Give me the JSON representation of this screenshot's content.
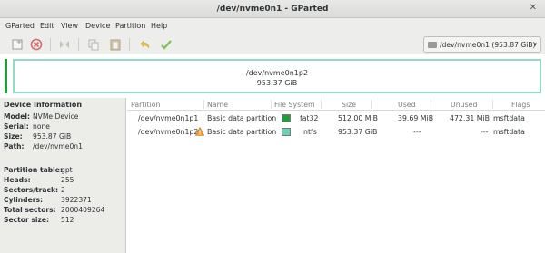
{
  "window": {
    "title": "/dev/nvme0n1 - GParted",
    "close_glyph": "✕"
  },
  "menu": [
    "GParted",
    "Edit",
    "View",
    "Device",
    "Partition",
    "Help"
  ],
  "toolbar": {
    "icons": [
      "new-partition-icon",
      "delete-partition-icon",
      "resize-move-icon",
      "copy-icon",
      "paste-icon",
      "undo-icon",
      "apply-icon"
    ],
    "device_selector": "/dev/nvme0n1 (953.87 GiB)",
    "arrow": "▾"
  },
  "disk_map": {
    "partition_name": "/dev/nvme0n1p2",
    "partition_size": "953.37 GiB",
    "accent_color": "#1f9e3b",
    "border_color": "#8fdcc4"
  },
  "device_info": {
    "heading": "Device Information",
    "group1": [
      {
        "key": "Model:",
        "value": "NVMe Device"
      },
      {
        "key": "Serial:",
        "value": "none"
      },
      {
        "key": "Size:",
        "value": "953.87 GiB"
      },
      {
        "key": "Path:",
        "value": "/dev/nvme0n1"
      }
    ],
    "group2": [
      {
        "key": "Partition table:",
        "value": "gpt"
      },
      {
        "key": "Heads:",
        "value": "255"
      },
      {
        "key": "Sectors/track:",
        "value": "2"
      },
      {
        "key": "Cylinders:",
        "value": "3922371"
      },
      {
        "key": "Total sectors:",
        "value": "2000409264"
      },
      {
        "key": "Sector size:",
        "value": "512"
      }
    ]
  },
  "table": {
    "columns": [
      "Partition",
      "Name",
      "File System",
      "Size",
      "Used",
      "Unused",
      "Flags"
    ],
    "rows": [
      {
        "partition": "/dev/nvme0n1p1",
        "name": "Basic data partition",
        "fs_color": "#1f9e3b",
        "fs": "fat32",
        "size": "512.00 MiB",
        "used": "39.69 MiB",
        "unused": "472.31 MiB",
        "flags": "msftdata"
      },
      {
        "partition": "/dev/nvme0n1p2",
        "name": "Basic data partition",
        "fs_color": "#66d3b4",
        "fs": "ntfs",
        "size": "953.37 GiB",
        "used": "---",
        "unused": "---",
        "flags": "msftdata"
      }
    ]
  }
}
